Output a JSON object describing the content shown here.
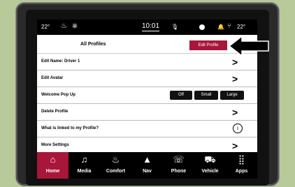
{
  "status": {
    "temp_left": "22°",
    "clock": "10:01",
    "temp_right": "22°"
  },
  "tabs": {
    "all_profiles": "All Profiles",
    "edit_profile": "Edit Profile"
  },
  "rows": [
    {
      "label": "Edit Name: Driver 1"
    },
    {
      "label": "Edit Avatar"
    },
    {
      "label": "Welcome Pop Up",
      "options": [
        "Off",
        "Small",
        "Large"
      ]
    },
    {
      "label": "Delete Profile"
    },
    {
      "label": "What is linked to my Profile?"
    },
    {
      "label": "More Settings"
    }
  ],
  "nav": [
    {
      "label": "Home",
      "icon": "home-icon"
    },
    {
      "label": "Media",
      "icon": "music-note-icon"
    },
    {
      "label": "Comfort",
      "icon": "seat-icon"
    },
    {
      "label": "Nav",
      "icon": "navigation-arrow-icon"
    },
    {
      "label": "Phone",
      "icon": "phone-icon"
    },
    {
      "label": "Vehicle",
      "icon": "car-icon"
    },
    {
      "label": "Apps",
      "icon": "apps-grid-icon"
    }
  ],
  "colors": {
    "accent": "#a8163a",
    "background": "#b8c99a"
  }
}
